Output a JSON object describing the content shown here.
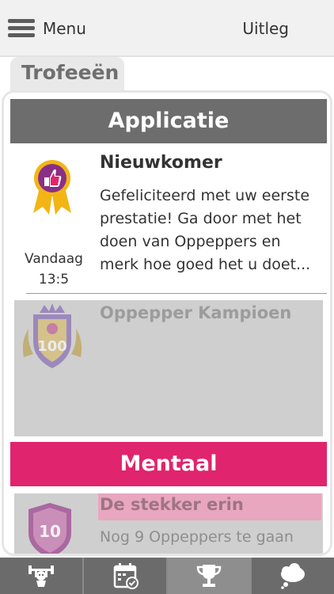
{
  "header": {
    "menu_label": "Menu",
    "help_label": "Uitleg"
  },
  "page": {
    "title": "Trofeeën"
  },
  "sections": [
    {
      "title": "Applicatie",
      "color": "#6d6d6d",
      "trophies": [
        {
          "title": "Nieuwkomer",
          "description": "Gefeliciteerd met uw eerste prestatie! Ga door met het doen van Oppeppers en merk hoe goed het u doet...",
          "date_line1": "Vandaag",
          "date_line2": "13:5",
          "icon": "thumbs-up-medal-icon",
          "earned": true
        },
        {
          "title": "Oppepper Kampioen",
          "badge_number": "100",
          "icon": "crown-shield-100-icon",
          "earned": false
        }
      ]
    },
    {
      "title": "Mentaal",
      "color": "#e0246d",
      "trophies": [
        {
          "title": "De stekker erin",
          "subtitle": "Nog 9 Oppeppers te gaan",
          "badge_number": "10",
          "icon": "shield-10-icon",
          "earned": false
        }
      ]
    }
  ],
  "bottom_nav": [
    {
      "icon": "exercise-icon",
      "active": false
    },
    {
      "icon": "calendar-check-icon",
      "active": false
    },
    {
      "icon": "trophy-icon",
      "active": true
    },
    {
      "icon": "thought-cloud-icon",
      "active": false
    }
  ],
  "colors": {
    "accent_pink": "#e0246d",
    "section_gray": "#6d6d6d",
    "nav_bg": "#6b6b6b",
    "medal_purple": "#8a2f86",
    "medal_gold": "#f3b515"
  }
}
